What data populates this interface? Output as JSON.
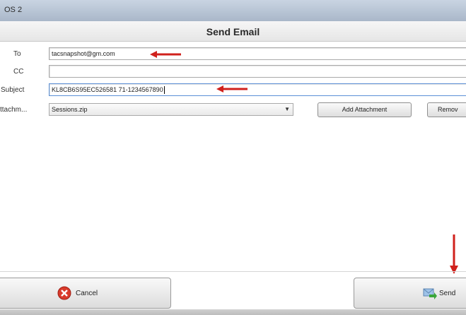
{
  "window": {
    "title": "OS 2"
  },
  "dialog": {
    "title": "Send Email"
  },
  "form": {
    "to_label": "To",
    "to_value": "tacsnapshot@gm.com",
    "cc_label": "CC",
    "cc_value": "",
    "subject_label": "Subject",
    "subject_value": "KL8CB6S95EC526581   71-1234567890",
    "attach_label": "ttachm...",
    "attach_selected": "Sessions.zip",
    "add_attachment_label": "Add Attachment",
    "remove_label": "Remov"
  },
  "footer": {
    "cancel_label": "Cancel",
    "send_label": "Send"
  },
  "colors": {
    "annotation_arrow": "#d0211c",
    "cancel_icon": "#d93a2b",
    "send_icon_arrow": "#3aa63a"
  },
  "icons": [
    "cancel-icon",
    "send-icon",
    "dropdown-arrow-icon"
  ]
}
